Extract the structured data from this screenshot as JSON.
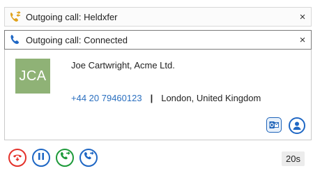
{
  "notifications": [
    {
      "title": "Outgoing call: Heldxfer",
      "icon": "call-transfer-icon",
      "close": "×"
    },
    {
      "title": "Outgoing call: Connected",
      "icon": "phone-icon",
      "close": "×"
    }
  ],
  "contact": {
    "initials": "JCA",
    "name": "Joe Cartwright, Acme Ltd.",
    "phone": "+44 20 79460123",
    "separator": "|",
    "location": "London, United Kingdom",
    "avatar_color": "#8fb276"
  },
  "card_actions": [
    {
      "name": "outlook-icon"
    },
    {
      "name": "contact-profile-icon"
    }
  ],
  "controls": [
    {
      "name": "hangup-button",
      "icon": "hangup-icon",
      "color": "#e4322b"
    },
    {
      "name": "hold-button",
      "icon": "pause-icon",
      "color": "#1f67c4"
    },
    {
      "name": "transfer-button",
      "icon": "transfer-icon",
      "color": "#1e9a3a"
    },
    {
      "name": "consult-transfer-button",
      "icon": "consult-icon",
      "color": "#1f67c4"
    }
  ],
  "timer": "20s"
}
